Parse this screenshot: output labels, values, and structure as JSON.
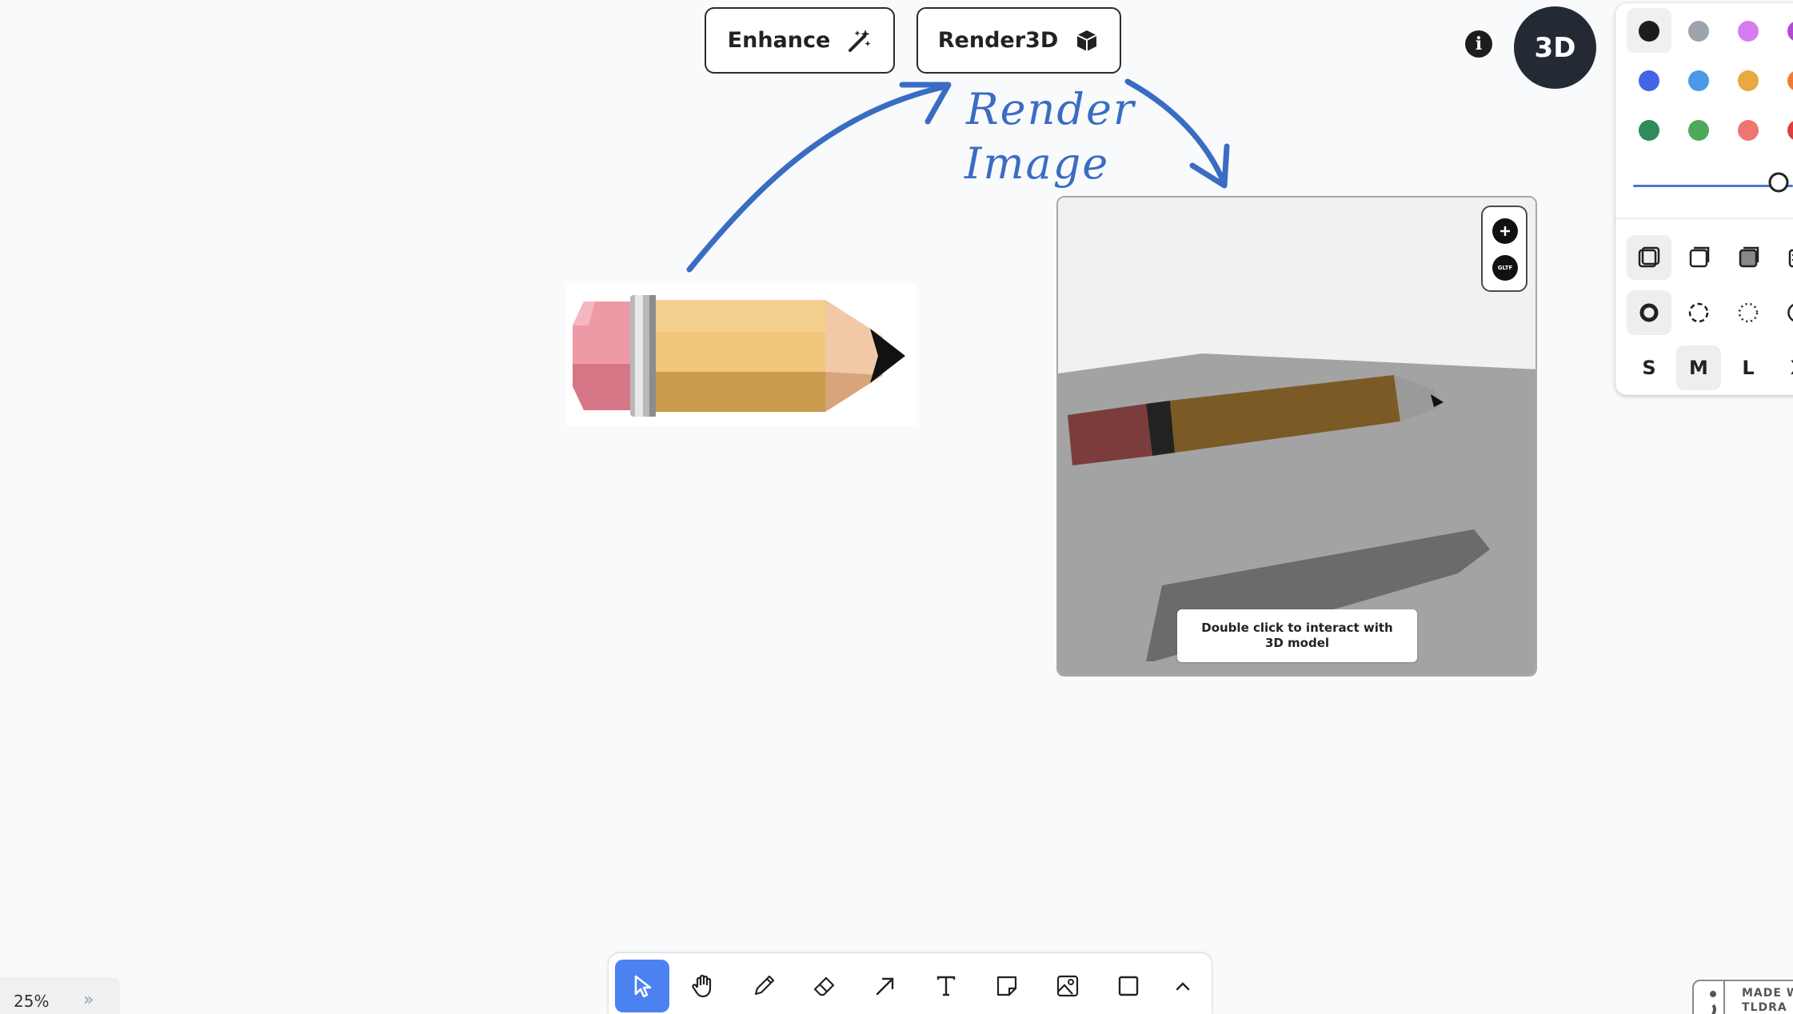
{
  "top_actions": {
    "enhance_label": "Enhance",
    "render3d_label": "Render3D"
  },
  "annotation": {
    "line1": "Render",
    "line2": "Image"
  },
  "header": {
    "info_icon": "info-icon",
    "mode_label": "3D"
  },
  "style_panel": {
    "colors": [
      "#1d1d1d",
      "#9ea4ab",
      "#d77cf0",
      "#b24ad6",
      "#4463e6",
      "#4a9ae8",
      "#e8a842",
      "#ee7c34",
      "#2f8a5c",
      "#4fa95a",
      "#ee7670",
      "#e03e3e"
    ],
    "selected_color": "#1d1d1d",
    "opacity_value": 1.0,
    "size_options": [
      "S",
      "M",
      "L",
      "X"
    ],
    "selected_size": "M"
  },
  "preview": {
    "zoom_control_icon": "plus-icon",
    "export_label": "GLTF",
    "hint": "Double click to interact with 3D model"
  },
  "toolbar": {
    "tools": [
      "select-tool",
      "hand-tool",
      "draw-tool",
      "eraser-tool",
      "arrow-tool",
      "text-tool",
      "note-tool",
      "image-tool",
      "rectangle-tool",
      "more-tools"
    ],
    "active_tool": "select-tool",
    "accent": "#4c82f0"
  },
  "footer": {
    "zoom_level": "25%",
    "collapse": "»",
    "badge_line1": "MADE W",
    "badge_line2": "TLDRA"
  }
}
